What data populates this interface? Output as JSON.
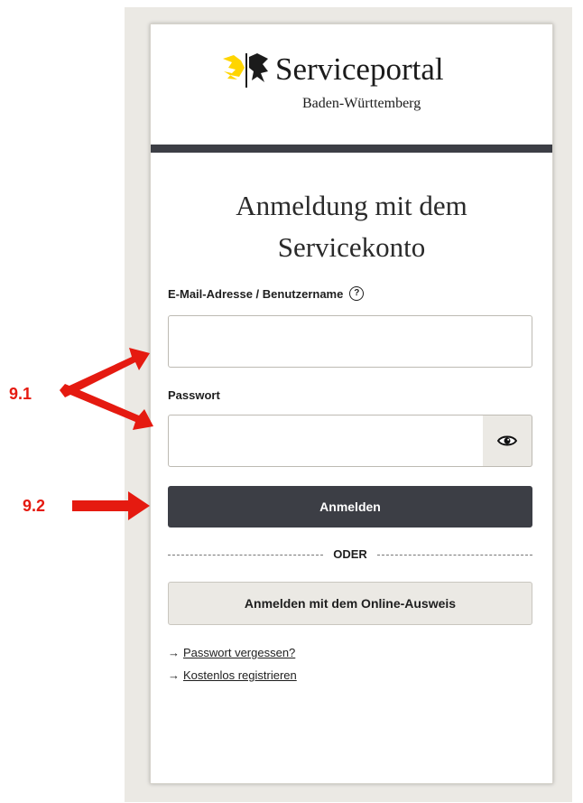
{
  "header": {
    "title": "Serviceportal",
    "subtitle": "Baden-Württemberg"
  },
  "login": {
    "heading_line1": "Anmeldung mit dem",
    "heading_line2": "Servicekonto",
    "email_label": "E-Mail-Adresse / Benutzername",
    "email_value": "",
    "password_label": "Passwort",
    "password_value": "",
    "submit_label": "Anmelden",
    "divider_text": "ODER",
    "eid_label": "Anmelden mit dem Online-Ausweis"
  },
  "links": [
    {
      "arrow": "→",
      "label": "Passwort vergessen?"
    },
    {
      "arrow": "→",
      "label": "Kostenlos registrieren"
    }
  ],
  "annotations": {
    "label_1": "9.1",
    "label_2": "9.2"
  },
  "icons": {
    "help": "question-circle-icon",
    "eye": "eye-icon",
    "lion": "lion-logo-icon"
  },
  "colors": {
    "dark": "#3c3e45",
    "backdrop": "#ebe9e4",
    "annotation": "#e51a10",
    "lion_yellow": "#ffd500"
  }
}
